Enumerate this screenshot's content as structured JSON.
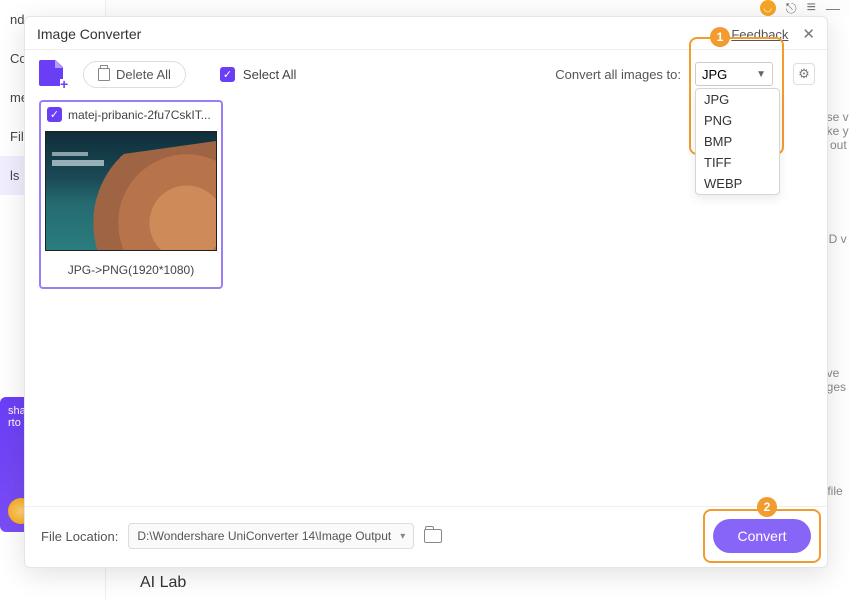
{
  "bg": {
    "left_items": [
      "nde",
      "Co",
      "me",
      "File",
      "ls"
    ],
    "ailab": "AI Lab",
    "right_peek": [
      "use v",
      "ake y",
      "d out",
      "HD v",
      "nve",
      "ages",
      "r file"
    ]
  },
  "modal": {
    "title": "Image Converter",
    "feedback": "Feedback",
    "close": "✕"
  },
  "toolbar": {
    "delete_all": "Delete All",
    "select_all": "Select All",
    "convert_label": "Convert all images to:",
    "selected_format": "JPG",
    "format_options": [
      "JPG",
      "PNG",
      "BMP",
      "TIFF",
      "WEBP"
    ]
  },
  "annotations": {
    "badge1": "1",
    "badge2": "2"
  },
  "thumbs": [
    {
      "filename": "matej-pribanic-2fu7CskIT...",
      "conversion": "JPG->PNG(1920*1080)"
    }
  ],
  "footer": {
    "location_label": "File Location:",
    "location_value": "D:\\Wondershare UniConverter 14\\Image Output",
    "convert": "Convert"
  }
}
